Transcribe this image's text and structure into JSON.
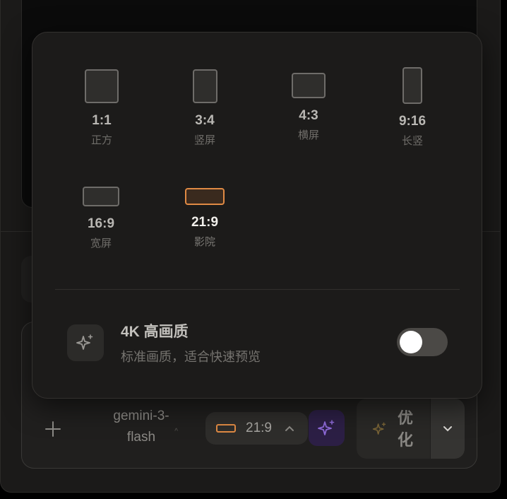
{
  "popover": {
    "ratios": [
      {
        "ratio": "1:1",
        "label": "正方",
        "active": false
      },
      {
        "ratio": "3:4",
        "label": "竖屏",
        "active": false
      },
      {
        "ratio": "4:3",
        "label": "横屏",
        "active": false
      },
      {
        "ratio": "9:16",
        "label": "长竖",
        "active": false
      },
      {
        "ratio": "16:9",
        "label": "宽屏",
        "active": false
      },
      {
        "ratio": "21:9",
        "label": "影院",
        "active": true
      }
    ],
    "hq": {
      "title": "4K 高画质",
      "description": "标准画质，适合快速预览",
      "enabled": false
    }
  },
  "toolbar": {
    "model_name": "gemini-3-flash",
    "ratio_value": "21:9",
    "optimize_label": "优化"
  },
  "colors": {
    "accent": "#e08a44",
    "magic": "#8e6ad8",
    "surface": "#1c1b1a"
  },
  "icons": {
    "plus": "plus-icon",
    "sparkle": "sparkle-icon",
    "chevron_down": "chevron-down-icon",
    "chevron_up": "chevron-up-icon"
  }
}
